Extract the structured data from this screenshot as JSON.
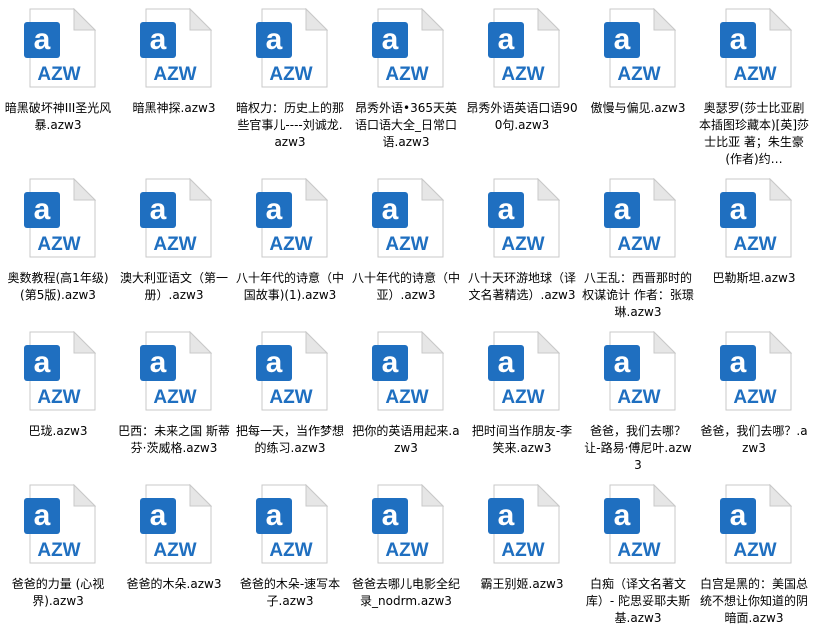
{
  "explorer": {
    "icon_badge_letter": "a",
    "icon_type_label": "AZW",
    "accent_color": "#1f6fc0",
    "files": [
      {
        "name": "暗黑破坏神III圣光风暴.azw3"
      },
      {
        "name": "暗黑神探.azw3"
      },
      {
        "name": "暗权力：历史上的那些官事儿----刘诚龙.azw3"
      },
      {
        "name": "昂秀外语•365天英语口语大全_日常口语.azw3"
      },
      {
        "name": "昂秀外语英语口语900句.azw3"
      },
      {
        "name": "傲慢与偏见.azw3"
      },
      {
        "name": "奥瑟罗(莎士比亚剧本插图珍藏本)[英]莎士比亚 著；朱生豪(作者)约…"
      },
      {
        "name": "奥数教程(高1年级)(第5版).azw3"
      },
      {
        "name": "澳大利亚语文（第一册）.azw3"
      },
      {
        "name": "八十年代的诗意（中国故事)(1).azw3"
      },
      {
        "name": "八十年代的诗意（中亚）.azw3"
      },
      {
        "name": "八十天环游地球（译文名著精选）.azw3"
      },
      {
        "name": "八王乱：西晋那时的权谋诡计 作者：张璟琳.azw3"
      },
      {
        "name": "巴勒斯坦.azw3"
      },
      {
        "name": "巴珑.azw3"
      },
      {
        "name": "巴西：未来之国 斯蒂芬·茨威格.azw3"
      },
      {
        "name": "把每一天，当作梦想的练习.azw3"
      },
      {
        "name": "把你的英语用起来.azw3"
      },
      {
        "name": "把时间当作朋友-李笑来.azw3"
      },
      {
        "name": "爸爸，我们去哪？ 让-路易·傅尼叶.azw3"
      },
      {
        "name": "爸爸，我们去哪？.azw3"
      },
      {
        "name": "爸爸的力量 (心视界).azw3"
      },
      {
        "name": "爸爸的木朵.azw3"
      },
      {
        "name": "爸爸的木朵-速写本子.azw3"
      },
      {
        "name": "爸爸去哪儿电影全纪录_nodrm.azw3"
      },
      {
        "name": "霸王别姬.azw3"
      },
      {
        "name": "白痴（译文名著文库）- 陀思妥耶夫斯基.azw3"
      },
      {
        "name": "白宫是黑的：美国总统不想让你知道的阴暗面.azw3"
      }
    ]
  }
}
